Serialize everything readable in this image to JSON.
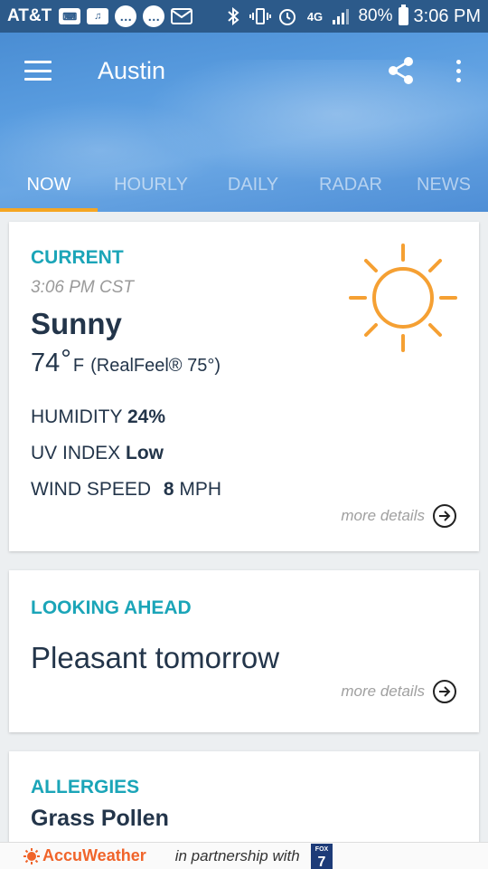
{
  "status_bar": {
    "carrier": "AT&T",
    "battery": "80%",
    "time": "3:06 PM"
  },
  "header": {
    "city": "Austin",
    "tabs": [
      {
        "label": "NOW",
        "active": true
      },
      {
        "label": "HOURLY",
        "active": false
      },
      {
        "label": "DAILY",
        "active": false
      },
      {
        "label": "RADAR",
        "active": false
      },
      {
        "label": "NEWS",
        "active": false
      }
    ],
    "accent_color": "#f5a623"
  },
  "current": {
    "title": "CURRENT",
    "time": "3:06 PM CST",
    "condition": "Sunny",
    "temperature": "74",
    "temp_unit": "F",
    "realfeel": "(RealFeel® 75°)",
    "humidity_label": "HUMIDITY",
    "humidity_value": "24%",
    "uv_label": "UV INDEX",
    "uv_value": "Low",
    "wind_label": "WIND SPEED",
    "wind_value": "8",
    "wind_unit": "MPH",
    "more_details": "more details",
    "icon": "sun-icon"
  },
  "looking_ahead": {
    "title": "LOOKING AHEAD",
    "text": "Pleasant tomorrow",
    "more_details": "more details"
  },
  "allergies": {
    "title": "ALLERGIES",
    "item": "Grass Pollen"
  },
  "footer": {
    "brand": "AccuWeather",
    "partnership": "in partnership with",
    "partner_logo_text": "FOX 7"
  },
  "colors": {
    "section_title": "#1ba5b8",
    "sun": "#f5a033",
    "brand": "#f0642a"
  }
}
